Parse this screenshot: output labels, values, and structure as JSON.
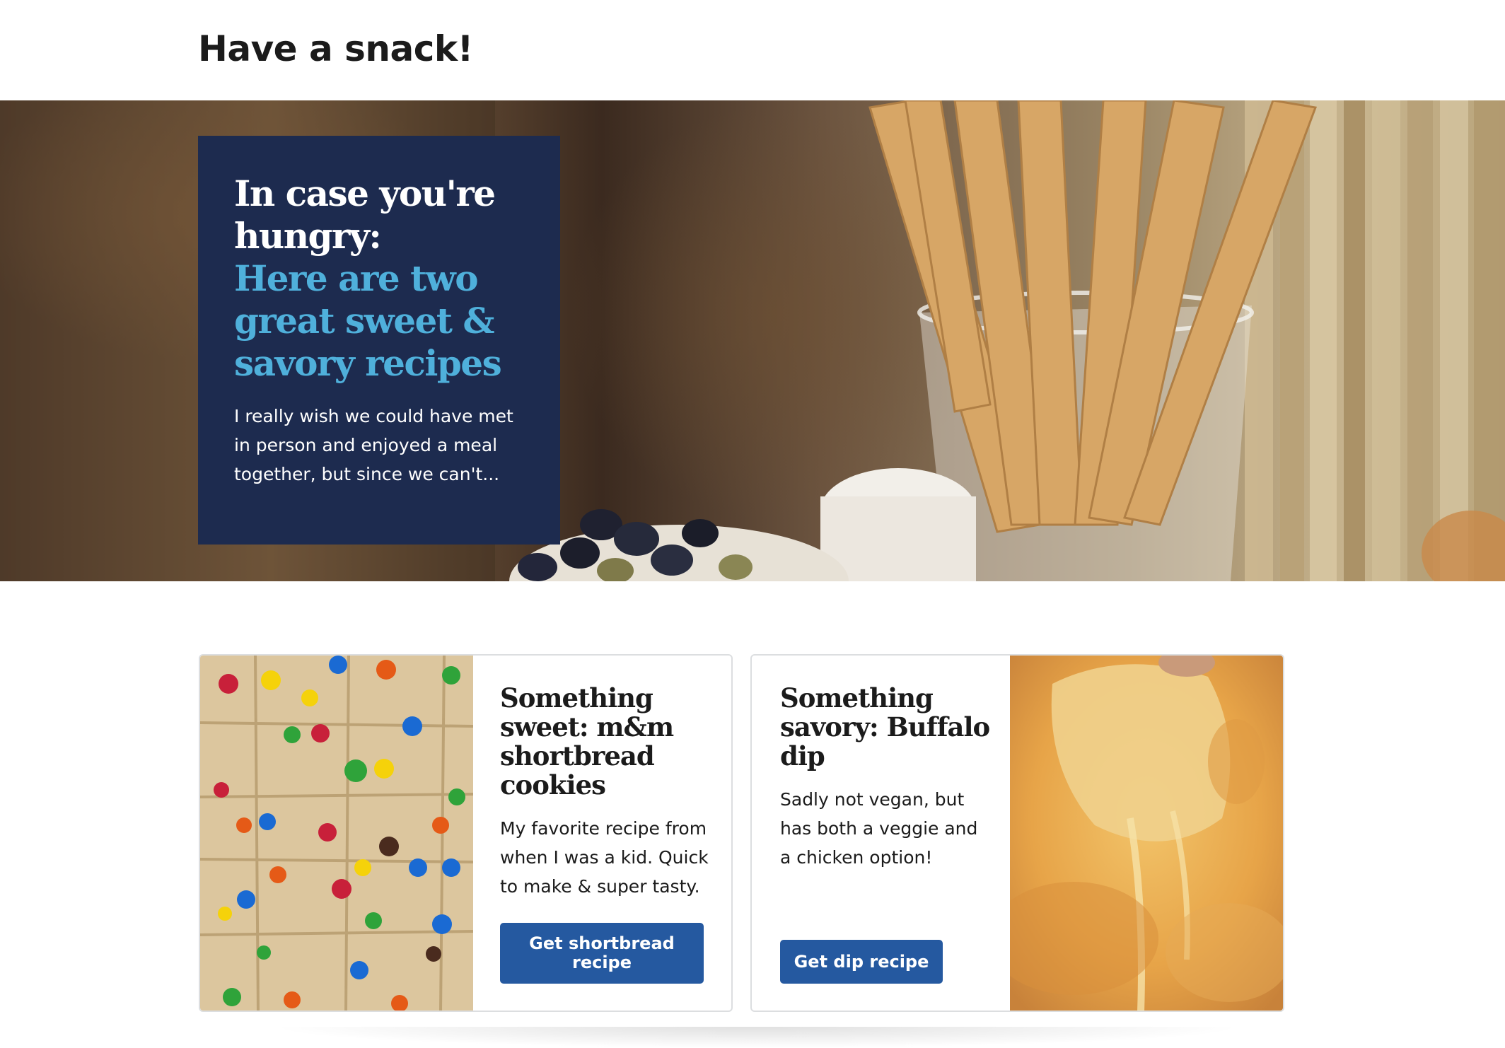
{
  "header": {
    "title": "Have a snack!"
  },
  "hero": {
    "heading": "In case you're hungry:",
    "subheading": "Here are two great sweet & savory recipes",
    "text": "I really wish we could have met in person and enjoyed a meal together, but since we can't..."
  },
  "cards": [
    {
      "heading": "Something sweet: m&m shortbread cookies",
      "text": "My favorite recipe from when I was a kid. Quick to make & super tasty.",
      "button": "Get shortbread recipe"
    },
    {
      "heading": "Something savory: Buffalo dip",
      "text": "Sadly not vegan, but has both a veggie and a chicken option!",
      "button": "Get dip recipe"
    }
  ],
  "colors": {
    "hero_card_bg": "#1d2b4f",
    "accent_heading": "#4fb0db",
    "button_bg": "#2559a0"
  }
}
